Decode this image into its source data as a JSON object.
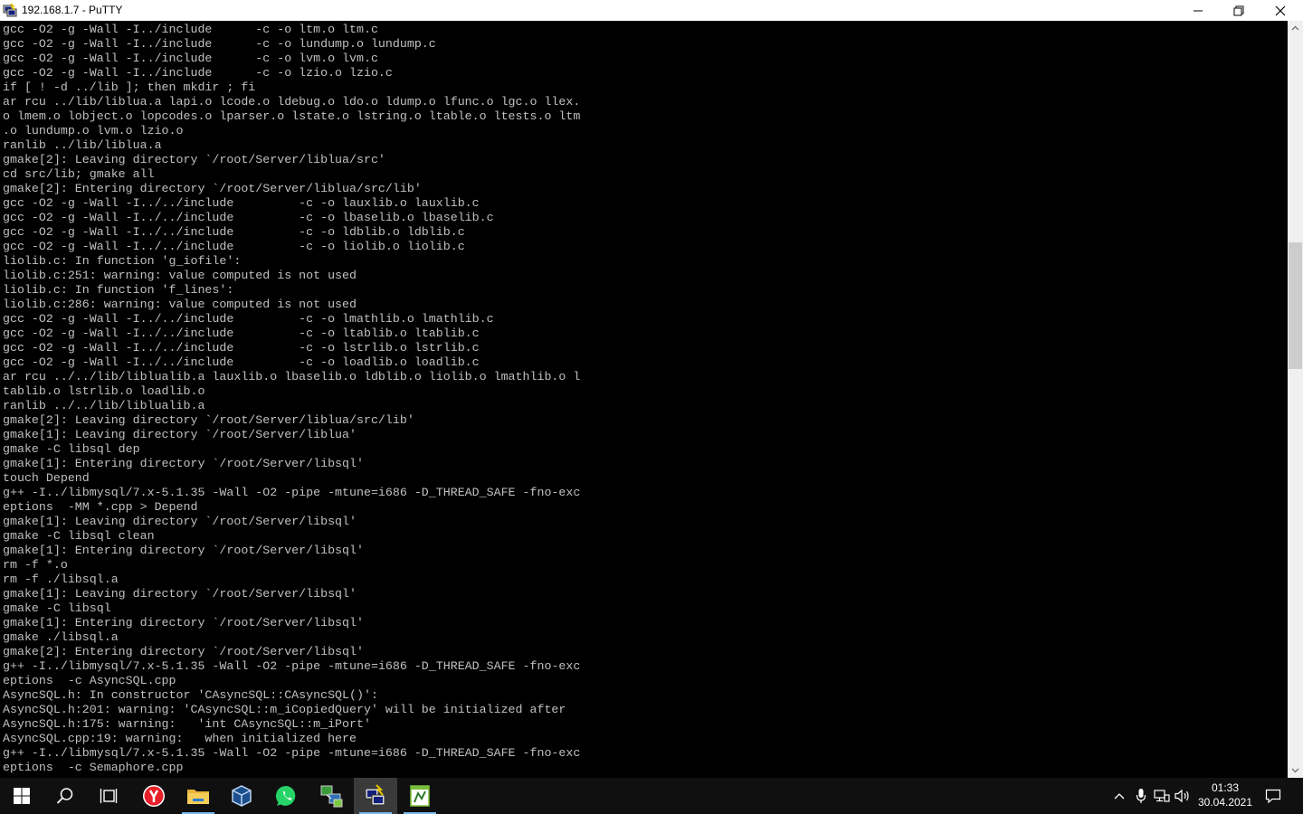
{
  "window": {
    "title": "192.168.1.7 - PuTTY"
  },
  "terminal": {
    "lines": [
      "gcc -O2 -g -Wall -I../include      -c -o ltm.o ltm.c",
      "gcc -O2 -g -Wall -I../include      -c -o lundump.o lundump.c",
      "gcc -O2 -g -Wall -I../include      -c -o lvm.o lvm.c",
      "gcc -O2 -g -Wall -I../include      -c -o lzio.o lzio.c",
      "if [ ! -d ../lib ]; then mkdir ; fi",
      "ar rcu ../lib/liblua.a lapi.o lcode.o ldebug.o ldo.o ldump.o lfunc.o lgc.o llex.",
      "o lmem.o lobject.o lopcodes.o lparser.o lstate.o lstring.o ltable.o ltests.o ltm",
      ".o lundump.o lvm.o lzio.o",
      "ranlib ../lib/liblua.a",
      "gmake[2]: Leaving directory `/root/Server/liblua/src'",
      "cd src/lib; gmake all",
      "gmake[2]: Entering directory `/root/Server/liblua/src/lib'",
      "gcc -O2 -g -Wall -I../../include         -c -o lauxlib.o lauxlib.c",
      "gcc -O2 -g -Wall -I../../include         -c -o lbaselib.o lbaselib.c",
      "gcc -O2 -g -Wall -I../../include         -c -o ldblib.o ldblib.c",
      "gcc -O2 -g -Wall -I../../include         -c -o liolib.o liolib.c",
      "liolib.c: In function 'g_iofile':",
      "liolib.c:251: warning: value computed is not used",
      "liolib.c: In function 'f_lines':",
      "liolib.c:286: warning: value computed is not used",
      "gcc -O2 -g -Wall -I../../include         -c -o lmathlib.o lmathlib.c",
      "gcc -O2 -g -Wall -I../../include         -c -o ltablib.o ltablib.c",
      "gcc -O2 -g -Wall -I../../include         -c -o lstrlib.o lstrlib.c",
      "gcc -O2 -g -Wall -I../../include         -c -o loadlib.o loadlib.c",
      "ar rcu ../../lib/liblualib.a lauxlib.o lbaselib.o ldblib.o liolib.o lmathlib.o l",
      "tablib.o lstrlib.o loadlib.o",
      "ranlib ../../lib/liblualib.a",
      "gmake[2]: Leaving directory `/root/Server/liblua/src/lib'",
      "gmake[1]: Leaving directory `/root/Server/liblua'",
      "gmake -C libsql dep",
      "gmake[1]: Entering directory `/root/Server/libsql'",
      "touch Depend",
      "g++ -I../libmysql/7.x-5.1.35 -Wall -O2 -pipe -mtune=i686 -D_THREAD_SAFE -fno-exc",
      "eptions  -MM *.cpp > Depend",
      "gmake[1]: Leaving directory `/root/Server/libsql'",
      "gmake -C libsql clean",
      "gmake[1]: Entering directory `/root/Server/libsql'",
      "rm -f *.o",
      "rm -f ./libsql.a",
      "gmake[1]: Leaving directory `/root/Server/libsql'",
      "gmake -C libsql",
      "gmake[1]: Entering directory `/root/Server/libsql'",
      "gmake ./libsql.a",
      "gmake[2]: Entering directory `/root/Server/libsql'",
      "g++ -I../libmysql/7.x-5.1.35 -Wall -O2 -pipe -mtune=i686 -D_THREAD_SAFE -fno-exc",
      "eptions  -c AsyncSQL.cpp",
      "AsyncSQL.h: In constructor 'CAsyncSQL::CAsyncSQL()':",
      "AsyncSQL.h:201: warning: 'CAsyncSQL::m_iCopiedQuery' will be initialized after",
      "AsyncSQL.h:175: warning:   'int CAsyncSQL::m_iPort'",
      "AsyncSQL.cpp:19: warning:   when initialized here",
      "g++ -I../libmysql/7.x-5.1.35 -Wall -O2 -pipe -mtune=i686 -D_THREAD_SAFE -fno-exc",
      "eptions  -c Semaphore.cpp"
    ]
  },
  "taskbar": {
    "apps": [
      {
        "name": "start-icon"
      },
      {
        "name": "search-icon"
      },
      {
        "name": "task-view-icon"
      },
      {
        "name": "yandex-browser-icon"
      },
      {
        "name": "file-explorer-icon"
      },
      {
        "name": "virtualbox-icon"
      },
      {
        "name": "whatsapp-icon"
      },
      {
        "name": "network-app-icon"
      },
      {
        "name": "putty-icon"
      },
      {
        "name": "notepad-plus-plus-icon"
      }
    ],
    "clock": {
      "time": "01:33",
      "date": "30.04.2021"
    }
  },
  "colors": {
    "terminal_fg": "#c0c0c0",
    "terminal_bg": "#000000",
    "taskbar_bg": "#101010",
    "accent": "#76b9ed"
  }
}
